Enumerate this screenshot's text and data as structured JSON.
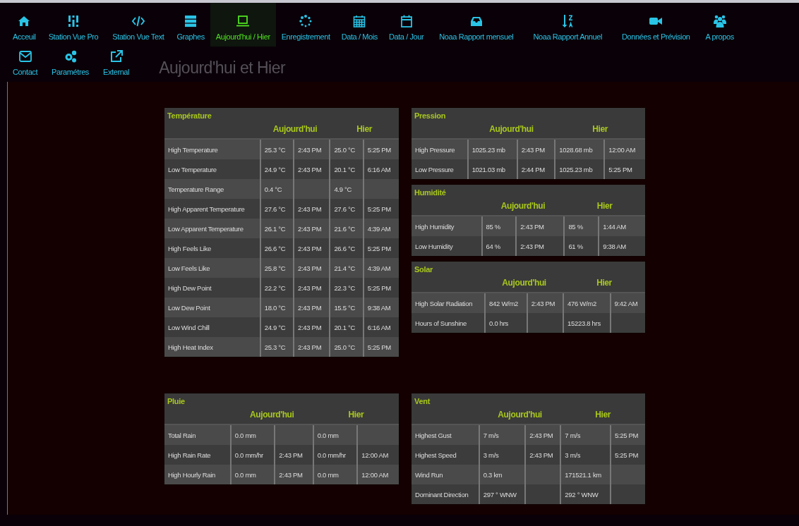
{
  "nav": [
    {
      "label": "Acceuil",
      "selected": false
    },
    {
      "label": "Station Vue Pro",
      "selected": false
    },
    {
      "label": "Station Vue Text",
      "selected": false
    },
    {
      "label": "Graphes",
      "selected": false
    },
    {
      "label": "Aujourd'hui / Hier",
      "selected": true
    },
    {
      "label": "Enregistrement",
      "selected": false
    },
    {
      "label": "Data / Mois",
      "selected": false
    },
    {
      "label": "Data / Jour",
      "selected": false
    },
    {
      "label": "Noaa Rapport mensuel",
      "selected": false
    },
    {
      "label": "Noaa Rapport Annuel",
      "selected": false
    },
    {
      "label": "Données et Prévision",
      "selected": false
    },
    {
      "label": "A propos",
      "selected": false
    },
    {
      "label": "Contact",
      "selected": false
    },
    {
      "label": "Paramétres",
      "selected": false
    },
    {
      "label": "External",
      "selected": false
    }
  ],
  "page_title": "Aujourd'hui et Hier",
  "sections": [
    {
      "left": [
        {
          "title": "Température",
          "today_heading": "Aujourd'hui",
          "yesterday_heading": "Hier",
          "rows": [
            {
              "label": "High Temperature",
              "today": "25.3 °C",
              "today_time": "2:43 PM",
              "yesterday": "25.0 °C",
              "yesterday_time": "5:25 PM"
            },
            {
              "label": "Low Temperature",
              "today": "24.9 °C",
              "today_time": "2:43 PM",
              "yesterday": "20.1 °C",
              "yesterday_time": "6:16 AM"
            },
            {
              "label": "Temperature Range",
              "today": "0.4 °C",
              "yesterday": "4.9 °C"
            },
            {
              "label": "High Apparent Temperature",
              "today": "27.6 °C",
              "today_time": "2:43 PM",
              "yesterday": "27.6 °C",
              "yesterday_time": "5:25 PM"
            },
            {
              "label": "Low Apparent Temperature",
              "today": "26.1 °C",
              "today_time": "2:43 PM",
              "yesterday": "21.6 °C",
              "yesterday_time": "4:39 AM"
            },
            {
              "label": "High Feels Like",
              "today": "26.6 °C",
              "today_time": "2:43 PM",
              "yesterday": "26.6 °C",
              "yesterday_time": "5:25 PM"
            },
            {
              "label": "Low Feels Like",
              "today": "25.8 °C",
              "today_time": "2:43 PM",
              "yesterday": "21.4 °C",
              "yesterday_time": "4:39 AM"
            },
            {
              "label": "High Dew Point",
              "today": "22.2 °C",
              "today_time": "2:43 PM",
              "yesterday": "22.3 °C",
              "yesterday_time": "5:25 PM"
            },
            {
              "label": "Low Dew Point",
              "today": "18.0 °C",
              "today_time": "2:43 PM",
              "yesterday": "15.5 °C",
              "yesterday_time": "9:38 AM"
            },
            {
              "label": "Low Wind Chill",
              "today": "24.9 °C",
              "today_time": "2:43 PM",
              "yesterday": "20.1 °C",
              "yesterday_time": "6:16 AM"
            },
            {
              "label": "High Heat Index",
              "today": "25.3 °C",
              "today_time": "2:43 PM",
              "yesterday": "25.0 °C",
              "yesterday_time": "5:25 PM"
            }
          ]
        }
      ],
      "right": [
        {
          "title": "Pression",
          "today_heading": "Aujourd'hui",
          "yesterday_heading": "Hier",
          "rows": [
            {
              "label": "High Pressure",
              "today": "1025.23 mb",
              "today_time": "2:43 PM",
              "yesterday": "1028.68 mb",
              "yesterday_time": "12:00 AM"
            },
            {
              "label": "Low Pressure",
              "today": "1021.03 mb",
              "today_time": "2:44 PM",
              "yesterday": "1025.23 mb",
              "yesterday_time": "5:25 PM"
            }
          ]
        },
        {
          "title": "Humidité",
          "today_heading": "Aujourd'hui",
          "yesterday_heading": "Hier",
          "rows": [
            {
              "label": "High Humidity",
              "today": "85 %",
              "today_time": "2:43 PM",
              "yesterday": "85 %",
              "yesterday_time": "1:44 AM"
            },
            {
              "label": "Low Humidity",
              "today": "64 %",
              "today_time": "2:43 PM",
              "yesterday": "61 %",
              "yesterday_time": "9:38 AM"
            }
          ]
        },
        {
          "title": "Solar",
          "today_heading": "Aujourd'hui",
          "yesterday_heading": "Hier",
          "rows": [
            {
              "label": "High Solar Radiation",
              "today": "842 W/m2",
              "today_time": "2:43 PM",
              "yesterday": "476 W/m2",
              "yesterday_time": "9:42 AM"
            },
            {
              "label": "Hours of Sunshine",
              "today": "0.0 hrs",
              "yesterday": "15223.8 hrs"
            }
          ]
        }
      ]
    },
    {
      "left": [
        {
          "title": "Pluie",
          "today_heading": "Aujourd'hui",
          "yesterday_heading": "Hier",
          "rows": [
            {
              "label": "Total Rain",
              "today": "0.0 mm",
              "yesterday": "0.0 mm"
            },
            {
              "label": "High Rain Rate",
              "today": "0.0 mm/hr",
              "today_time": "2:43 PM",
              "yesterday": "0.0 mm/hr",
              "yesterday_time": "12:00 AM"
            },
            {
              "label": "High Hourly Rain",
              "today": "0.0 mm",
              "today_time": "2:43 PM",
              "yesterday": "0.0 mm",
              "yesterday_time": "12:00 AM"
            }
          ]
        }
      ],
      "right": [
        {
          "title": "Vent",
          "today_heading": "Aujourd'hui",
          "yesterday_heading": "Hier",
          "rows": [
            {
              "label": "Highest Gust",
              "today": "7 m/s",
              "today_time": "2:43 PM",
              "yesterday": "7 m/s",
              "yesterday_time": "5:25 PM"
            },
            {
              "label": "Highest Speed",
              "today": "3 m/s",
              "today_time": "2:43 PM",
              "yesterday": "3 m/s",
              "yesterday_time": "5:25 PM"
            },
            {
              "label": "Wind Run",
              "today": "0.3 km",
              "yesterday": "171521.1 km"
            },
            {
              "label": "Dominant Direction",
              "today": "297 ° WNW",
              "yesterday": "292 ° WNW"
            }
          ]
        }
      ]
    }
  ]
}
